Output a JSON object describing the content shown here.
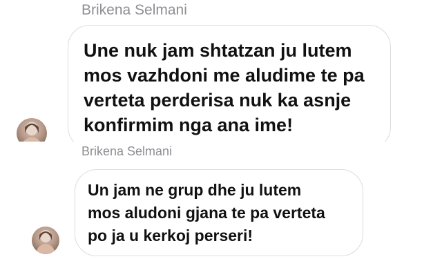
{
  "messages": [
    {
      "sender": "Brikena Selmani",
      "lines": [
        "Une nuk jam shtatzan ju lutem",
        "mos vazhdoni me aludime te pa",
        "verteta perderisa nuk ka asnje",
        "konfirmim nga ana ime!"
      ],
      "avatar_icon": "profile-photo-avatar"
    },
    {
      "sender": "Brikena Selmani",
      "lines": [
        "Un jam ne grup dhe ju lutem",
        "mos aludoni gjana te pa verteta",
        "po ja u kerkoj perseri!"
      ],
      "avatar_icon": "profile-photo-avatar"
    }
  ],
  "colors": {
    "background": "#ffffff",
    "sender_name": "#8e8e93",
    "bubble_border": "#dcdcdf",
    "message_text": "#111111"
  }
}
